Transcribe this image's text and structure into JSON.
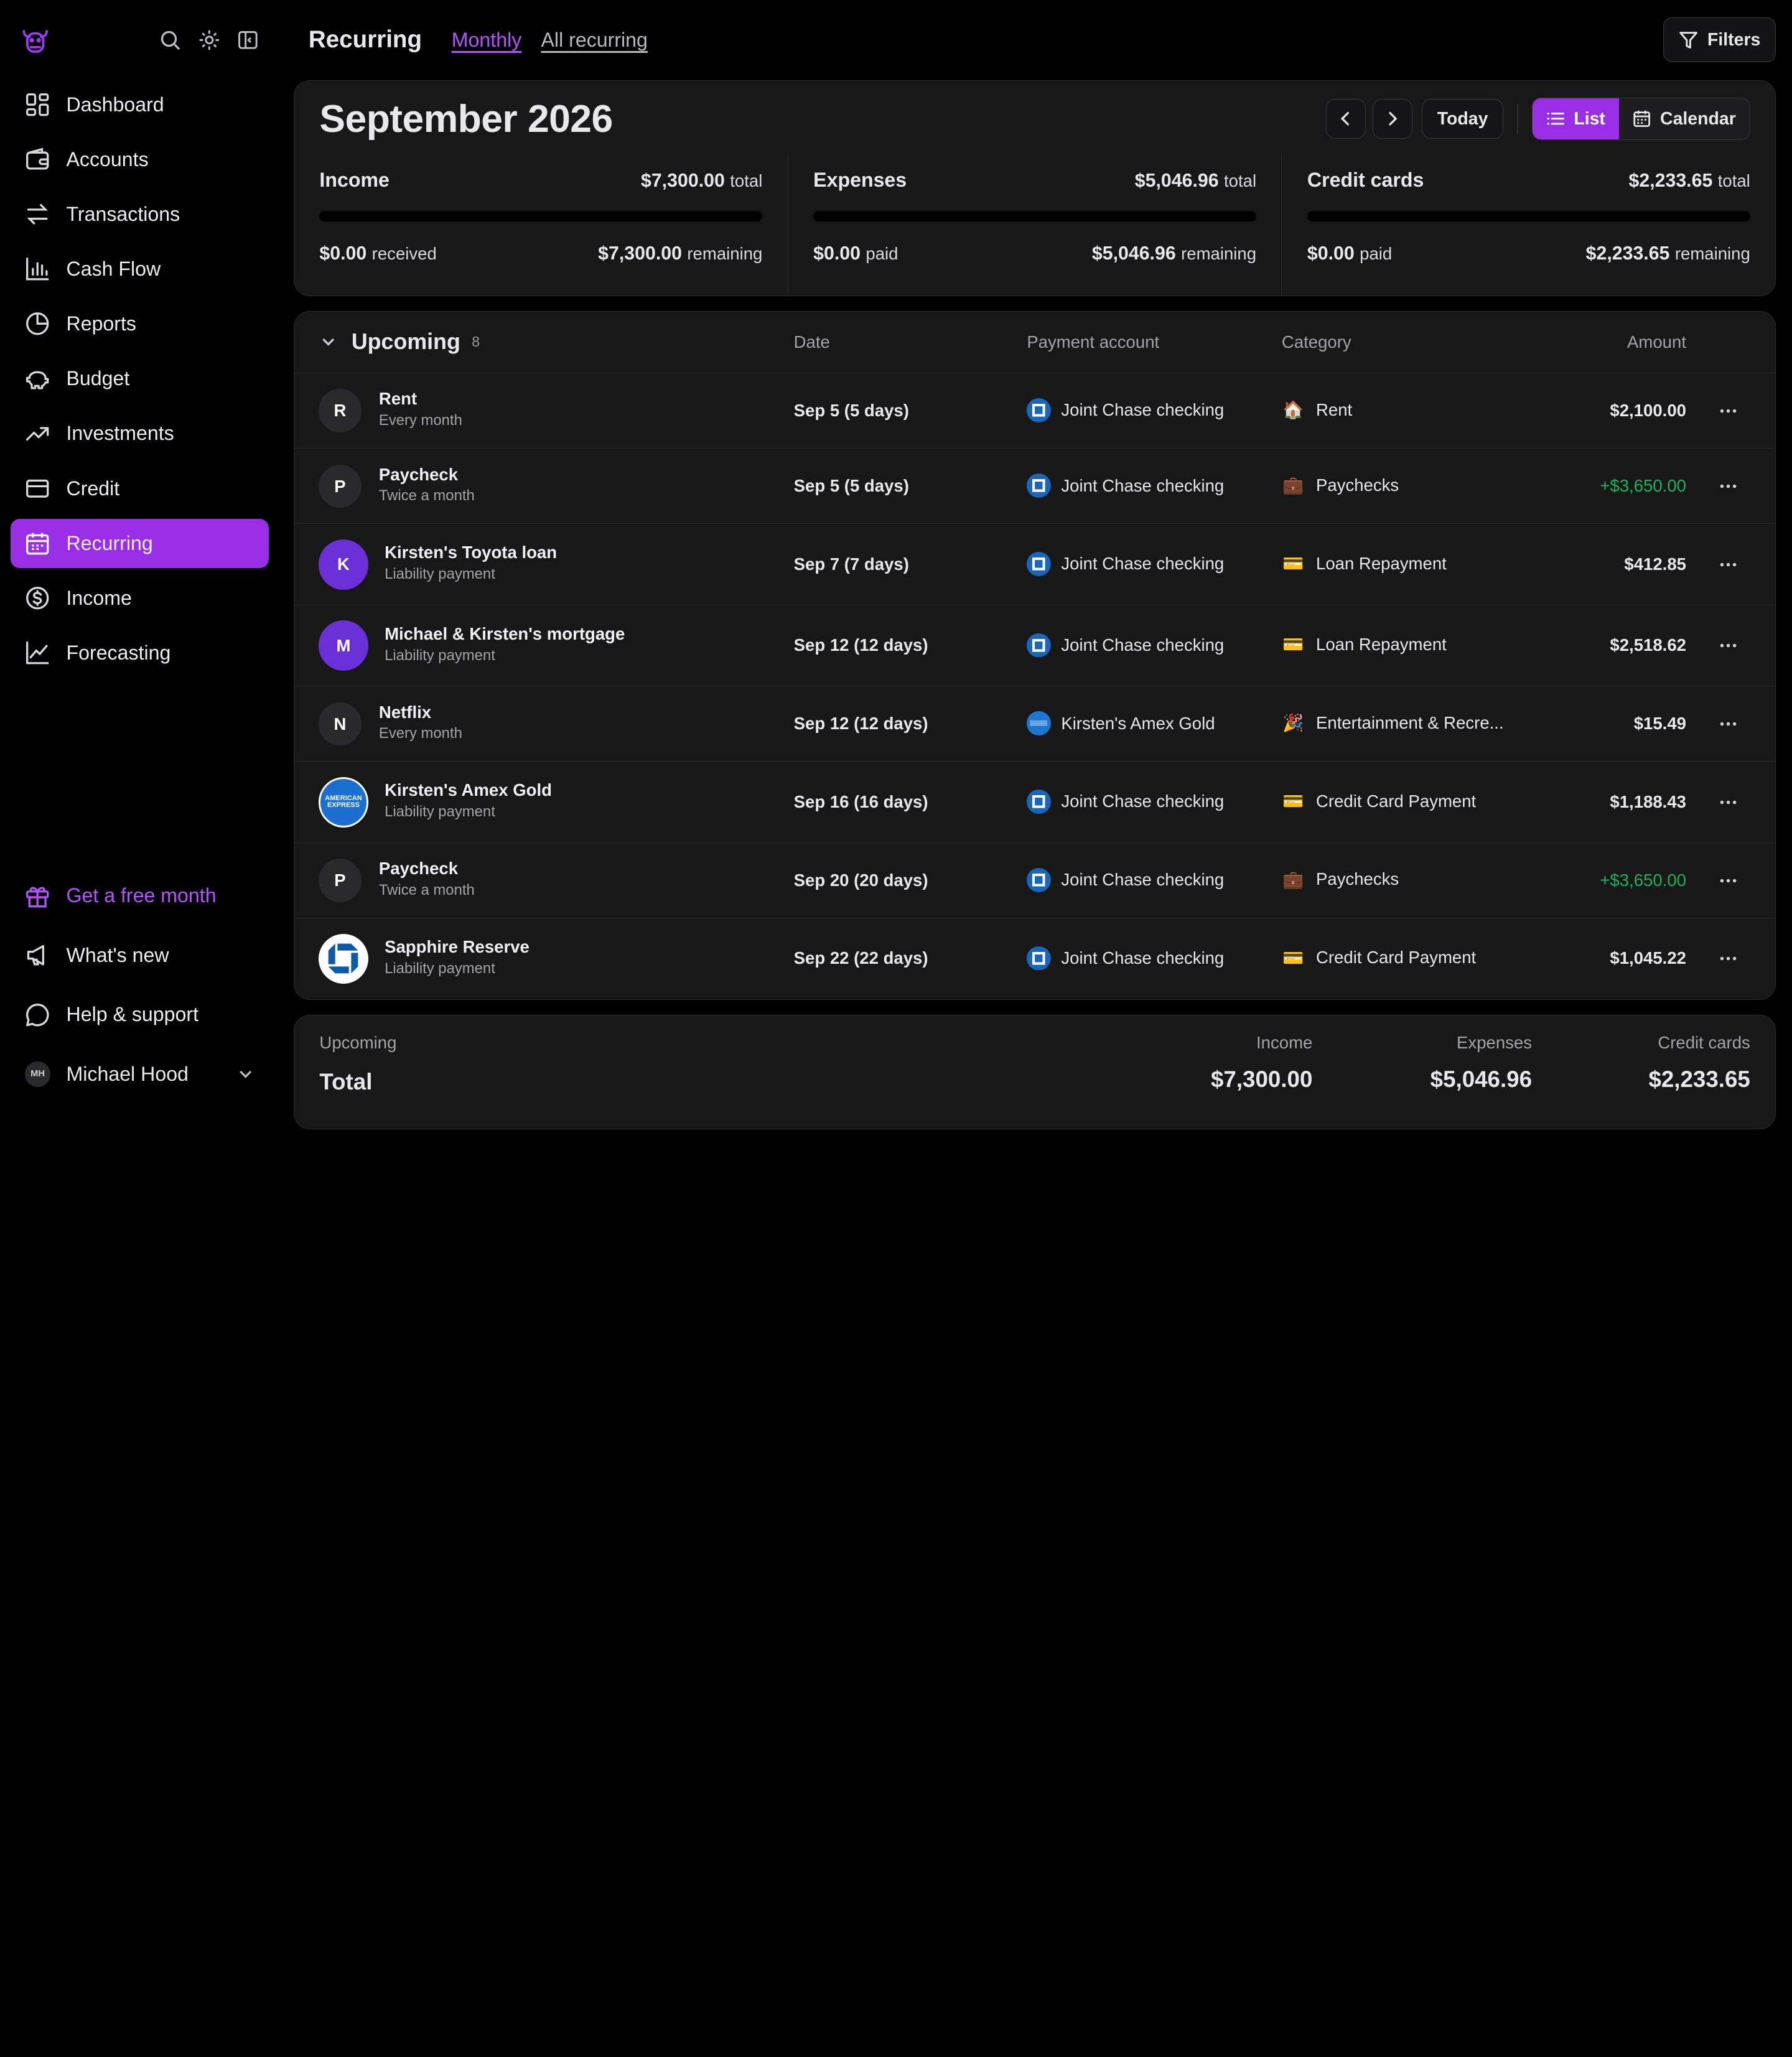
{
  "sidebar": {
    "items": [
      {
        "label": "Dashboard"
      },
      {
        "label": "Accounts"
      },
      {
        "label": "Transactions"
      },
      {
        "label": "Cash Flow"
      },
      {
        "label": "Reports"
      },
      {
        "label": "Budget"
      },
      {
        "label": "Investments"
      },
      {
        "label": "Credit"
      },
      {
        "label": "Recurring"
      },
      {
        "label": "Income"
      },
      {
        "label": "Forecasting"
      }
    ],
    "bottom": {
      "promo": "Get a free month",
      "whats_new": "What's new",
      "help": "Help & support",
      "user_initials": "MH",
      "user_name": "Michael Hood"
    }
  },
  "header": {
    "title": "Recurring",
    "tabs": [
      "Monthly",
      "All recurring"
    ],
    "filters": "Filters"
  },
  "summary": {
    "month": "September 2026",
    "today": "Today",
    "view_list": "List",
    "view_calendar": "Calendar",
    "stats": [
      {
        "label": "Income",
        "total": "$7,300.00",
        "total_suffix": "total",
        "done": "$0.00",
        "done_suffix": "received",
        "remaining": "$7,300.00",
        "remaining_suffix": "remaining",
        "progress": 0
      },
      {
        "label": "Expenses",
        "total": "$5,046.96",
        "total_suffix": "total",
        "done": "$0.00",
        "done_suffix": "paid",
        "remaining": "$5,046.96",
        "remaining_suffix": "remaining",
        "progress": 0
      },
      {
        "label": "Credit cards",
        "total": "$2,233.65",
        "total_suffix": "total",
        "done": "$0.00",
        "done_suffix": "paid",
        "remaining": "$2,233.65",
        "remaining_suffix": "remaining",
        "progress": 0
      }
    ]
  },
  "upcoming": {
    "title": "Upcoming",
    "count": "8",
    "columns": {
      "date": "Date",
      "account": "Payment account",
      "category": "Category",
      "amount": "Amount"
    },
    "rows": [
      {
        "initial": "R",
        "name": "Rent",
        "sub": "Every month",
        "date": "Sep 5 (5 days)",
        "account": "Joint Chase checking",
        "account_icon": "chase-icon",
        "category": "Rent",
        "cat_emoji": "🏠",
        "amount": "$2,100.00",
        "positive": false
      },
      {
        "initial": "P",
        "name": "Paycheck",
        "sub": "Twice a month",
        "date": "Sep 5 (5 days)",
        "account": "Joint Chase checking",
        "account_icon": "chase-icon",
        "category": "Paychecks",
        "cat_emoji": "💼",
        "amount": "+$3,650.00",
        "positive": true
      },
      {
        "initial": "K",
        "name": "Kirsten's Toyota loan",
        "sub": "Liability payment",
        "date": "Sep 7 (7 days)",
        "account": "Joint Chase checking",
        "account_icon": "chase-icon",
        "category": "Loan Repayment",
        "cat_emoji": "💳",
        "amount": "$412.85",
        "positive": false
      },
      {
        "initial": "M",
        "name": "Michael & Kirsten's mortgage",
        "sub": "Liability payment",
        "date": "Sep 12 (12 days)",
        "account": "Joint Chase checking",
        "account_icon": "chase-icon",
        "category": "Loan Repayment",
        "cat_emoji": "💳",
        "amount": "$2,518.62",
        "positive": false
      },
      {
        "initial": "N",
        "name": "Netflix",
        "sub": "Every month",
        "date": "Sep 12 (12 days)",
        "account": "Kirsten's Amex Gold",
        "account_icon": "amex-icon",
        "category": "Entertainment & Recre...",
        "cat_emoji": "🎉",
        "amount": "$15.49",
        "positive": false
      },
      {
        "initial": "AMERICAN EXPRESS",
        "name": "Kirsten's Amex Gold",
        "sub": "Liability payment",
        "date": "Sep 16 (16 days)",
        "account": "Joint Chase checking",
        "account_icon": "chase-icon",
        "category": "Credit Card Payment",
        "cat_emoji": "💳",
        "amount": "$1,188.43",
        "positive": false
      },
      {
        "initial": "P",
        "name": "Paycheck",
        "sub": "Twice a month",
        "date": "Sep 20 (20 days)",
        "account": "Joint Chase checking",
        "account_icon": "chase-icon",
        "category": "Paychecks",
        "cat_emoji": "💼",
        "amount": "+$3,650.00",
        "positive": true
      },
      {
        "initial": "",
        "name": "Sapphire Reserve",
        "sub": "Liability payment",
        "date": "Sep 22 (22 days)",
        "account": "Joint Chase checking",
        "account_icon": "chase-icon",
        "category": "Credit Card Payment",
        "cat_emoji": "💳",
        "amount": "$1,045.22",
        "positive": false
      }
    ]
  },
  "footer": {
    "label": "Upcoming",
    "total_label": "Total",
    "income_label": "Income",
    "income": "$7,300.00",
    "expenses_label": "Expenses",
    "expenses": "$5,046.96",
    "credit_label": "Credit cards",
    "credit": "$2,233.65"
  },
  "colors": {
    "accent": "#9a2ee6",
    "positive": "#19b35c",
    "background": "#000000",
    "card": "#181819"
  }
}
